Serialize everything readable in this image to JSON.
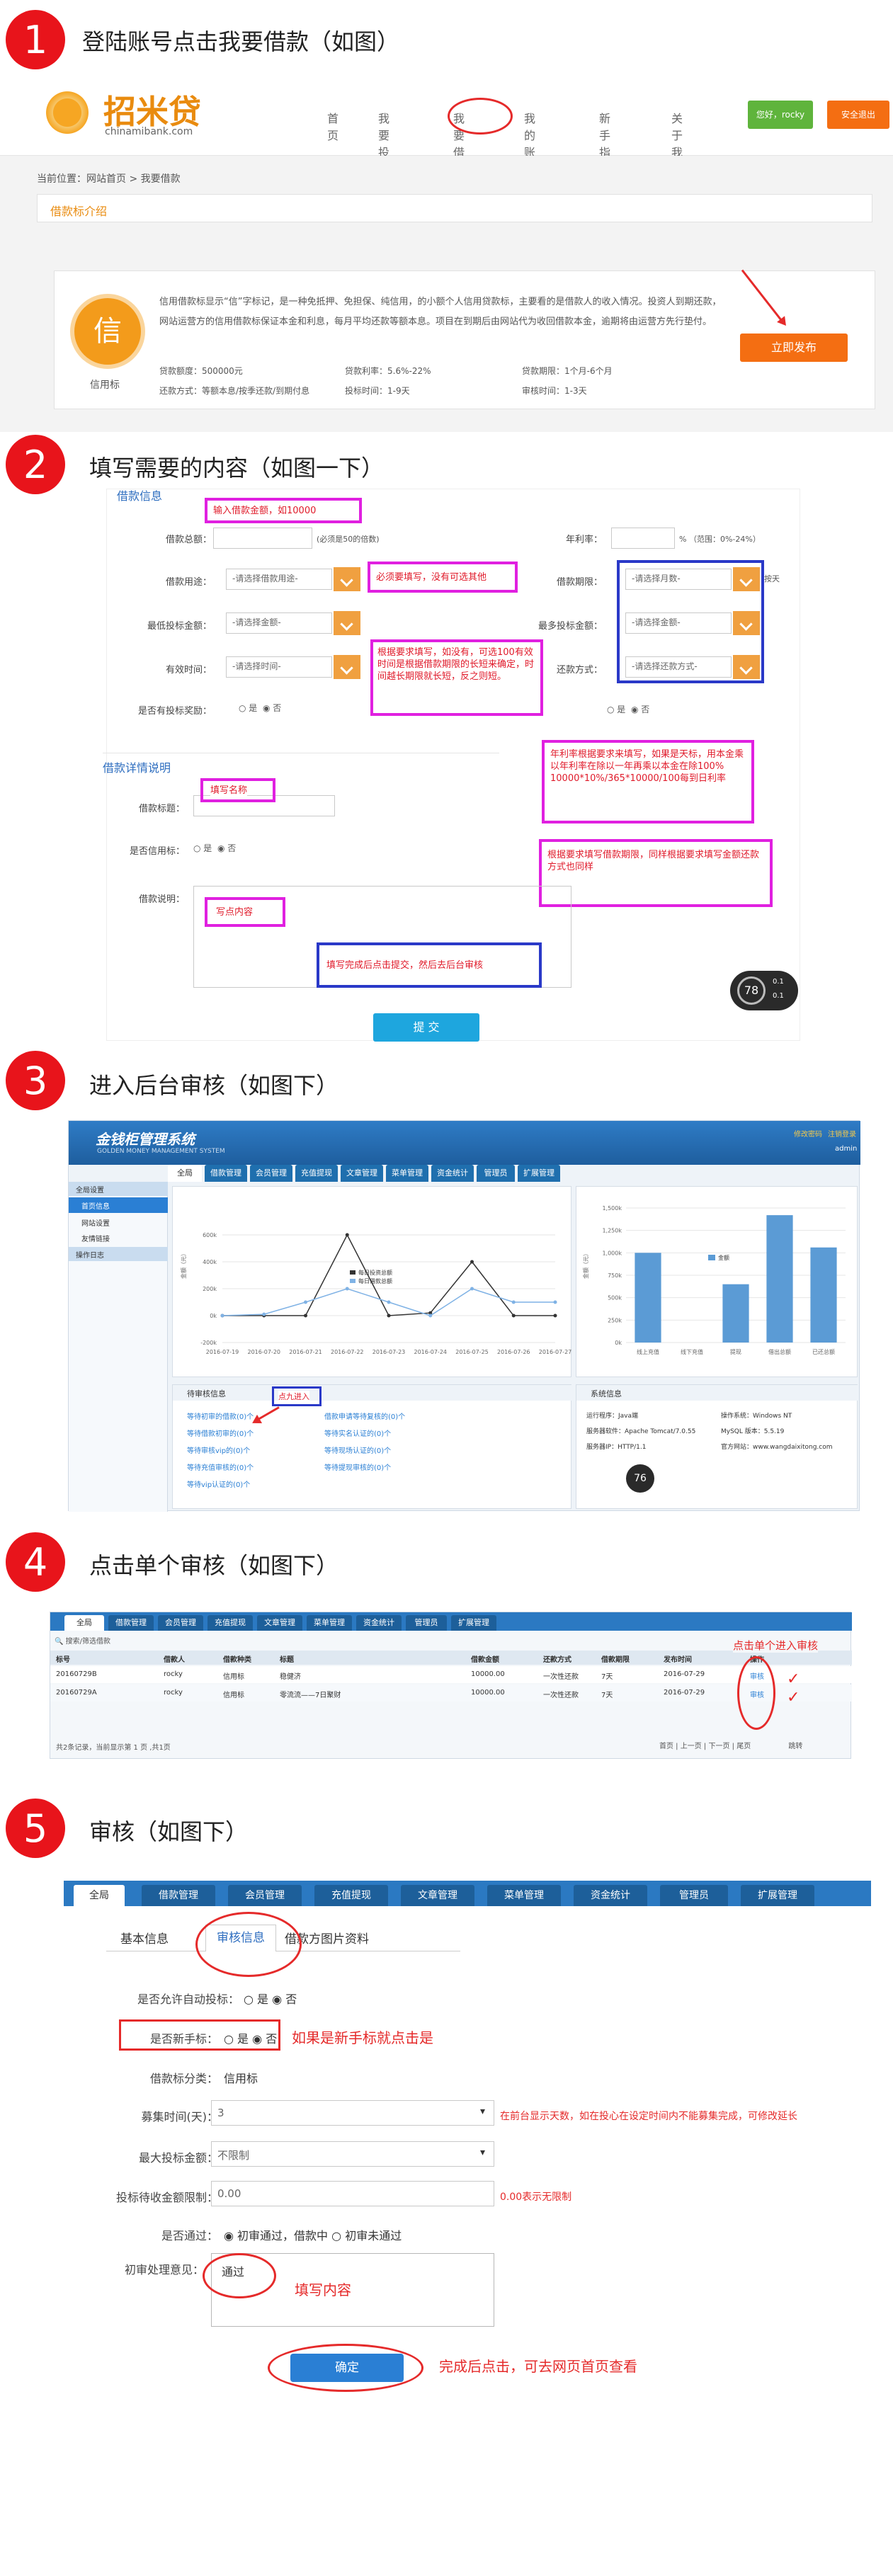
{
  "steps": [
    {
      "num": "1",
      "title": "登陆账号点击我要借款（如图）"
    },
    {
      "num": "2",
      "title": "填写需要的内容（如图一下）"
    },
    {
      "num": "3",
      "title": "进入后台审核（如图下）"
    },
    {
      "num": "4",
      "title": "点击单个审核（如图下）"
    },
    {
      "num": "5",
      "title": "审核（如图下）"
    }
  ],
  "site": {
    "logo_text": "招米贷",
    "logo_url": "chinamibank.com",
    "nav": [
      "首页",
      "我要投资",
      "我要借款",
      "我的账户",
      "新手指引",
      "关于我们"
    ],
    "user_btn": "您好，rocky",
    "logout_btn": "安全退出",
    "breadcrumb": "当前位置：网站首页 > 我要借款",
    "section_title": "借款标介绍",
    "badge_char": "信",
    "badge_label": "信用标",
    "desc": "信用借款标显示“信”字标记，是一种免抵押、免担保、纯信用，的小额个人信用贷款标，主要看的是借款人的收入情况。投资人到期还款，网站运营方的信用借款标保证本金和利息，每月平均还款等额本息。项目在到期后由网站代为收回借款本金，逾期将由运营方先行垫付。",
    "info": [
      "贷款额度：500000元",
      "贷款利率：5.6%-22%",
      "贷款期限：1个月-6个月",
      "还款方式：等额本息/按季还款/到期付息",
      "投标时间：1-9天",
      "审核时间：1-3天"
    ],
    "publish_btn": "立即发布"
  },
  "form": {
    "header": "借款信息",
    "amount_label": "借款总额：",
    "amount_hint": "(必须是50的倍数)",
    "rate_label": "年利率：",
    "rate_hint": "% （范围：0%-24%）",
    "use_label": "借款用途：",
    "use_ph": "-请选择借款用途-",
    "term_label": "借款期限：",
    "term_ph": "-请选择月数-",
    "term_suffix": "按天",
    "min_label": "最低投标金额：",
    "min_ph": "-请选择金额-",
    "max_label": "最多投标金额：",
    "max_ph": "-请选择金额-",
    "valid_label": "有效时间：",
    "valid_ph": "-请选择时间-",
    "repay_label": "还款方式：",
    "repay_ph": "-请选择还款方式-",
    "reward_label": "是否有投标奖励：",
    "yes": "是",
    "no": "否",
    "desc_header": "借款详情说明",
    "title_label": "借款标题：",
    "show_label": "是否信用标：",
    "explain_label": "借款说明：",
    "submit": "提 交",
    "badge78": "78",
    "badge_side": [
      "0.1",
      "0.1"
    ],
    "notes": {
      "amount": "输入借款金额，如10000",
      "use": "必须要填写，没有可选其他",
      "valid": "根据要求填写，如没有，可选100有效时间是根据借款期限的长短来确定，时间越长期限就长短，反之则短。",
      "rate": "年利率根据要求来填写，如果是天标，用本金乘以年利率在除以一年再乘以本金在除100%\n10000*10%/365*10000/100每到日利率",
      "term": "根据要求填写借款期限，同样根据要求填写金额还款方式也同样",
      "title": "填写名称",
      "content": "写点内容",
      "submit": "填写完成后点击提交，然后去后台审核"
    }
  },
  "admin": {
    "title": "金钱柜管理系统",
    "subtitle": "GOLDEN MONEY MANAGEMENT SYSTEM",
    "top_links": [
      "修改密码",
      "注销登录"
    ],
    "user": "admin",
    "tabs": [
      "全局",
      "借款管理",
      "会员管理",
      "充值提现",
      "文章管理",
      "菜单管理",
      "资金统计",
      "管理员",
      "扩展管理"
    ],
    "side_header": "全局设置",
    "side_items": [
      "首页信息",
      "网站设置",
      "友情链接",
      "操作日志"
    ],
    "chart1_legend": [
      "每日投资总额",
      "每日借款总额"
    ],
    "chart1_y": [
      "600k",
      "400k",
      "200k",
      "0k",
      "-200k"
    ],
    "chart1_x": [
      "2016-07-19",
      "2016-07-20",
      "2016-07-21",
      "2016-07-22",
      "2016-07-23",
      "2016-07-24",
      "2016-07-25",
      "2016-07-26",
      "2016-07-27"
    ],
    "chart1_ylabel": "金额（元）",
    "chart2_legend": "金额",
    "chart2_y": [
      "1,500k",
      "1,250k",
      "1,000k",
      "750k",
      "500k",
      "250k",
      "0k"
    ],
    "chart2_x": [
      "线上充值",
      "线下充值",
      "提现",
      "借出总额",
      "已还总额"
    ],
    "chart2_ylabel": "金额（元）",
    "pending_title": "待审核信息",
    "pending_items": [
      "等待初审的借款(0)个",
      "借款申请等待复核的(0)个",
      "等待借款初审的(0)个",
      "等待实名认证的(0)个",
      "等待审核vip的(0)个",
      "等待现场认证的(0)个",
      "等待充值审核的(0)个",
      "等待提现审核的(0)个",
      "等待vip认证的(0)个"
    ],
    "pending_note": "点九进入",
    "sys_title": "系统信息",
    "sys_items": [
      "运行程序：Java端",
      "操作系统：Windows NT",
      "服务器软件：Apache Tomcat/7.0.55",
      "MySQL 版本：5.5.19",
      "服务器IP：HTTP/1.1",
      "官方网站：www.wangdaixitong.com"
    ],
    "sys_badge": "76"
  },
  "list": {
    "search_ph": "搜索/筛选借款",
    "headers": [
      "标号",
      "借款人",
      "借款种类",
      "标题",
      "借款金额",
      "还款方式",
      "借款期限",
      "发布时间",
      "操作"
    ],
    "rows": [
      [
        "20160729B",
        "rocky",
        "信用标",
        "稳健济",
        "10000.00",
        "一次性还款",
        "7天",
        "2016-07-29",
        "审核"
      ],
      [
        "20160729A",
        "rocky",
        "信用标",
        "零流流——7日聚财",
        "10000.00",
        "一次性还款",
        "7天",
        "2016-07-29",
        "审核"
      ]
    ],
    "footer": "共2条记录，当前显示第 1 页 ,共1页",
    "pager": [
      "首页",
      "上一页",
      "下一页",
      "尾页",
      "跳转"
    ],
    "note": "点击单个进入审核"
  },
  "review": {
    "tabs": [
      "基本信息",
      "审核信息",
      "借款方图片资料"
    ],
    "auto_label": "是否允许自动投标：",
    "newbie_label": "是否新手标：",
    "newbie_note": "如果是新手标就点击是",
    "type_label": "借款标分类：",
    "type_value": "信用标",
    "raise_label": "募集时间(天)：",
    "raise_value": "3",
    "raise_note": "在前台显示天数，如在投心在设定时间内不能募集完成，可修改延长",
    "max_label": "最大投标金额：",
    "max_value": "不限制",
    "limit_label": "投标待收金额限制：",
    "limit_value": "0.00",
    "limit_note": "0.00表示无限制",
    "pass_label": "是否通过：",
    "pass_opts": [
      "初审通过，借款中",
      "初审未通过"
    ],
    "opinion_label": "初审处理意见：",
    "opinion_value": "通过",
    "opinion_note": "填写内容",
    "confirm": "确定",
    "confirm_note": "完成后点击，可去网页首页查看"
  },
  "chart_data": [
    {
      "type": "line",
      "x": [
        "2016-07-19",
        "2016-07-20",
        "2016-07-21",
        "2016-07-22",
        "2016-07-23",
        "2016-07-24",
        "2016-07-25",
        "2016-07-26",
        "2016-07-27"
      ],
      "series": [
        {
          "name": "每日投资总额",
          "values": [
            0,
            0,
            0,
            600000,
            0,
            20000,
            400000,
            0,
            0
          ]
        },
        {
          "name": "每日借款总额",
          "values": [
            0,
            10000,
            100000,
            200000,
            100000,
            0,
            200000,
            100000,
            100000
          ]
        }
      ],
      "ylabel": "金额（元）",
      "ylim": [
        -200000,
        800000
      ]
    },
    {
      "type": "bar",
      "categories": [
        "线上充值",
        "线下充值",
        "提现",
        "借出总额",
        "已还总额"
      ],
      "values": [
        1000000,
        0,
        650000,
        1420000,
        1060000
      ],
      "ylabel": "金额（元）",
      "ylim": [
        0,
        1500000
      ]
    }
  ]
}
